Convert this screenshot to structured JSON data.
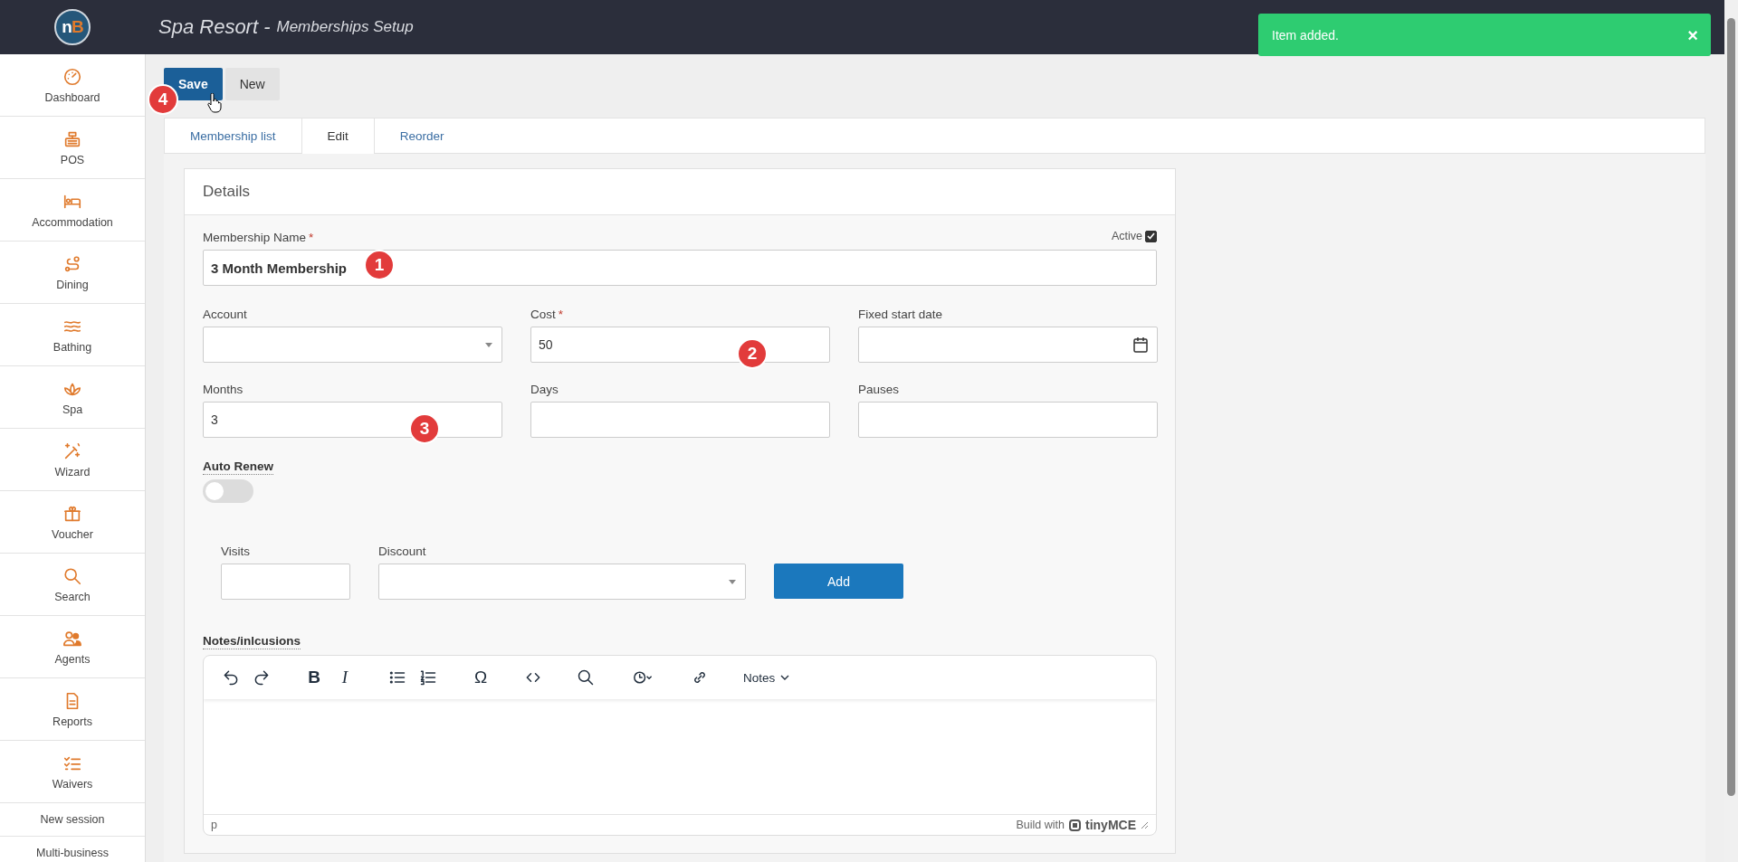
{
  "header": {
    "logo": [
      "n",
      "B"
    ],
    "title": "Spa Resort -",
    "subtitle": "Memberships Setup"
  },
  "toast": {
    "message": "Item added.",
    "close": "×"
  },
  "sidebar": {
    "items": [
      {
        "label": "Dashboard"
      },
      {
        "label": "POS"
      },
      {
        "label": "Accommodation"
      },
      {
        "label": "Dining"
      },
      {
        "label": "Bathing"
      },
      {
        "label": "Spa"
      },
      {
        "label": "Wizard"
      },
      {
        "label": "Voucher"
      },
      {
        "label": "Search"
      },
      {
        "label": "Agents"
      },
      {
        "label": "Reports"
      },
      {
        "label": "Waivers"
      }
    ],
    "links": [
      "New session",
      "Multi-business"
    ]
  },
  "toolbar": {
    "buttons": [
      {
        "label": "Save",
        "kind": "primary",
        "annotation": "4"
      },
      {
        "label": "New",
        "kind": "secondary"
      }
    ]
  },
  "tabs": [
    {
      "label": "Membership list",
      "selected": false
    },
    {
      "label": "Edit",
      "selected": true
    },
    {
      "label": "Reorder",
      "selected": false
    }
  ],
  "details": {
    "title": "Details",
    "active": {
      "label": "Active",
      "checked": true
    },
    "name_field": {
      "label": "Membership Name",
      "required_mark": "*",
      "value": "3 Month Membership",
      "annotation": "1"
    },
    "fields": [
      {
        "label": "Account",
        "kind": "select"
      },
      {
        "label": "Cost",
        "required_mark": "*",
        "kind": "text",
        "value": "50",
        "annotation": "2"
      },
      {
        "label": "Fixed start date",
        "kind": "date"
      },
      {
        "label": "Months",
        "kind": "text",
        "value": "3",
        "annotation": "3"
      },
      {
        "label": "Days",
        "kind": "text"
      },
      {
        "label": "Pauses",
        "kind": "text"
      }
    ],
    "auto_renew": {
      "label": "Auto Renew",
      "on": false
    },
    "visits": {
      "label": "Visits"
    },
    "discount": {
      "label": "Discount"
    },
    "add_button": "Add",
    "notes": {
      "label": "Notes/inlcusions",
      "glyphs": [
        "B",
        "I",
        "Ω"
      ],
      "format_menu": "Notes",
      "path": "p",
      "branding": "Build with",
      "brand": "tinyMCE"
    }
  }
}
